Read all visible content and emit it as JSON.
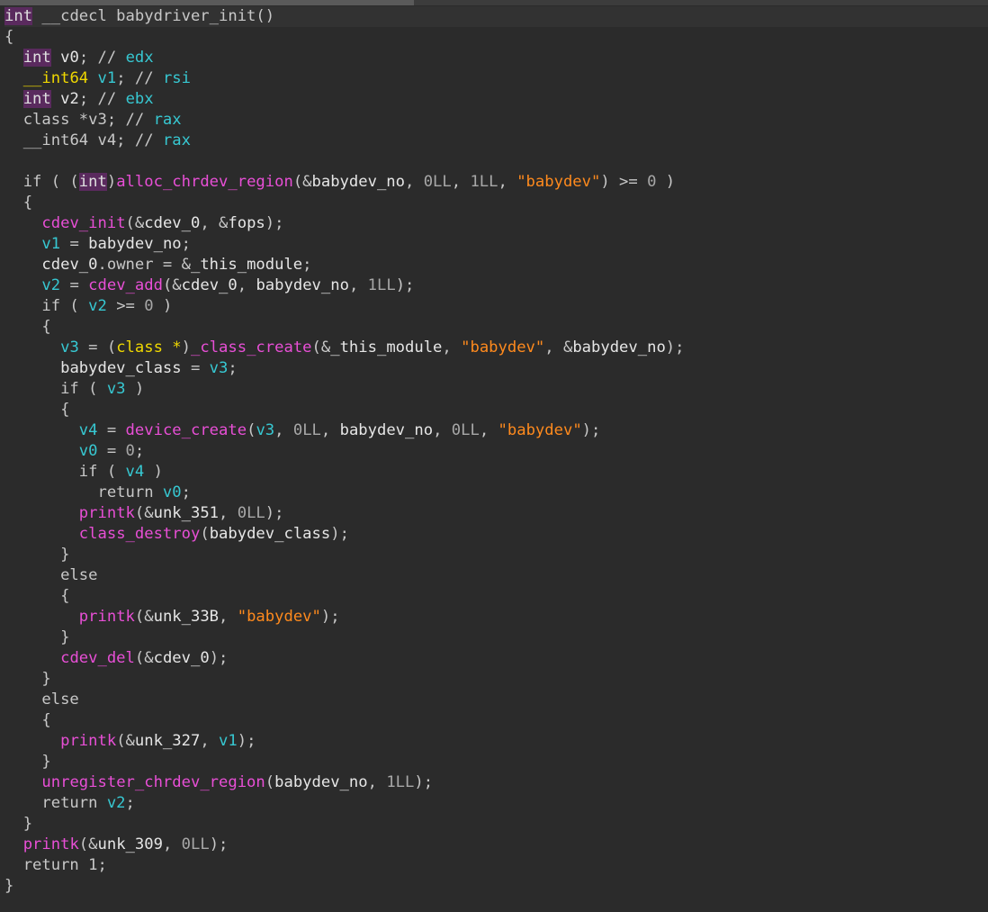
{
  "editor": {
    "lines": [
      [
        [
          "type",
          "int"
        ],
        [
          "default",
          " __cdecl babydriver_init()"
        ]
      ],
      [
        [
          "default",
          "{"
        ]
      ],
      [
        [
          "default",
          "  "
        ],
        [
          "type",
          "int"
        ],
        [
          "default",
          " "
        ],
        [
          "ident",
          "v0"
        ],
        [
          "default",
          "; // "
        ],
        [
          "reg",
          "edx"
        ]
      ],
      [
        [
          "default",
          "  "
        ],
        [
          "int64",
          "__int64"
        ],
        [
          "default",
          " "
        ],
        [
          "var",
          "v1"
        ],
        [
          "default",
          "; // "
        ],
        [
          "reg",
          "rsi"
        ]
      ],
      [
        [
          "default",
          "  "
        ],
        [
          "type",
          "int"
        ],
        [
          "default",
          " "
        ],
        [
          "ident",
          "v2"
        ],
        [
          "default",
          "; // "
        ],
        [
          "reg",
          "ebx"
        ]
      ],
      [
        [
          "default",
          "  "
        ],
        [
          "default",
          "class *v3; // "
        ],
        [
          "reg",
          "rax"
        ]
      ],
      [
        [
          "default",
          "  "
        ],
        [
          "default",
          "__int64 v4; // "
        ],
        [
          "reg",
          "rax"
        ]
      ],
      [
        [
          "default",
          ""
        ]
      ],
      [
        [
          "default",
          "  if ( ("
        ],
        [
          "type",
          "int"
        ],
        [
          "default",
          ")"
        ],
        [
          "func",
          "alloc_chrdev_region"
        ],
        [
          "default",
          "(&"
        ],
        [
          "ident",
          "babydev_no"
        ],
        [
          "default",
          ", "
        ],
        [
          "num",
          "0LL"
        ],
        [
          "default",
          ", "
        ],
        [
          "num",
          "1LL"
        ],
        [
          "default",
          ", "
        ],
        [
          "str",
          "\"babydev\""
        ],
        [
          "default",
          ") >= "
        ],
        [
          "num",
          "0"
        ],
        [
          "default",
          " )"
        ]
      ],
      [
        [
          "default",
          "  {"
        ]
      ],
      [
        [
          "default",
          "    "
        ],
        [
          "func",
          "cdev_init"
        ],
        [
          "default",
          "(&"
        ],
        [
          "ident",
          "cdev_0"
        ],
        [
          "default",
          ", &"
        ],
        [
          "ident",
          "fops"
        ],
        [
          "default",
          ");"
        ]
      ],
      [
        [
          "default",
          "    "
        ],
        [
          "var",
          "v1"
        ],
        [
          "default",
          " = "
        ],
        [
          "ident",
          "babydev_no"
        ],
        [
          "default",
          ";"
        ]
      ],
      [
        [
          "default",
          "    "
        ],
        [
          "ident",
          "cdev_0"
        ],
        [
          "default",
          ".owner = &"
        ],
        [
          "ident",
          "_this_module"
        ],
        [
          "default",
          ";"
        ]
      ],
      [
        [
          "default",
          "    "
        ],
        [
          "var",
          "v2"
        ],
        [
          "default",
          " = "
        ],
        [
          "func",
          "cdev_add"
        ],
        [
          "default",
          "(&"
        ],
        [
          "ident",
          "cdev_0"
        ],
        [
          "default",
          ", "
        ],
        [
          "ident",
          "babydev_no"
        ],
        [
          "default",
          ", "
        ],
        [
          "num",
          "1LL"
        ],
        [
          "default",
          ");"
        ]
      ],
      [
        [
          "default",
          "    if ( "
        ],
        [
          "var",
          "v2"
        ],
        [
          "default",
          " >= "
        ],
        [
          "num",
          "0"
        ],
        [
          "default",
          " )"
        ]
      ],
      [
        [
          "default",
          "    {"
        ]
      ],
      [
        [
          "default",
          "      "
        ],
        [
          "var",
          "v3"
        ],
        [
          "default",
          " = ("
        ],
        [
          "classkw",
          "class *"
        ],
        [
          "default",
          ")"
        ],
        [
          "func",
          "_class_create"
        ],
        [
          "default",
          "(&"
        ],
        [
          "ident",
          "_this_module"
        ],
        [
          "default",
          ", "
        ],
        [
          "str",
          "\"babydev\""
        ],
        [
          "default",
          ", &"
        ],
        [
          "ident",
          "babydev_no"
        ],
        [
          "default",
          ");"
        ]
      ],
      [
        [
          "default",
          "      "
        ],
        [
          "ident",
          "babydev_class"
        ],
        [
          "default",
          " = "
        ],
        [
          "var",
          "v3"
        ],
        [
          "default",
          ";"
        ]
      ],
      [
        [
          "default",
          "      if ( "
        ],
        [
          "var",
          "v3"
        ],
        [
          "default",
          " )"
        ]
      ],
      [
        [
          "default",
          "      {"
        ]
      ],
      [
        [
          "default",
          "        "
        ],
        [
          "var",
          "v4"
        ],
        [
          "default",
          " = "
        ],
        [
          "func",
          "device_create"
        ],
        [
          "default",
          "("
        ],
        [
          "var",
          "v3"
        ],
        [
          "default",
          ", "
        ],
        [
          "num",
          "0LL"
        ],
        [
          "default",
          ", "
        ],
        [
          "ident",
          "babydev_no"
        ],
        [
          "default",
          ", "
        ],
        [
          "num",
          "0LL"
        ],
        [
          "default",
          ", "
        ],
        [
          "str",
          "\"babydev\""
        ],
        [
          "default",
          ");"
        ]
      ],
      [
        [
          "default",
          "        "
        ],
        [
          "var",
          "v0"
        ],
        [
          "default",
          " = "
        ],
        [
          "num",
          "0"
        ],
        [
          "default",
          ";"
        ]
      ],
      [
        [
          "default",
          "        if ( "
        ],
        [
          "var",
          "v4"
        ],
        [
          "default",
          " )"
        ]
      ],
      [
        [
          "default",
          "          return "
        ],
        [
          "var",
          "v0"
        ],
        [
          "default",
          ";"
        ]
      ],
      [
        [
          "default",
          "        "
        ],
        [
          "func",
          "printk"
        ],
        [
          "default",
          "(&"
        ],
        [
          "ident",
          "unk_351"
        ],
        [
          "default",
          ", "
        ],
        [
          "num",
          "0LL"
        ],
        [
          "default",
          ");"
        ]
      ],
      [
        [
          "default",
          "        "
        ],
        [
          "func",
          "class_destroy"
        ],
        [
          "default",
          "("
        ],
        [
          "ident",
          "babydev_class"
        ],
        [
          "default",
          ");"
        ]
      ],
      [
        [
          "default",
          "      }"
        ]
      ],
      [
        [
          "default",
          "      else"
        ]
      ],
      [
        [
          "default",
          "      {"
        ]
      ],
      [
        [
          "default",
          "        "
        ],
        [
          "func",
          "printk"
        ],
        [
          "default",
          "(&"
        ],
        [
          "ident",
          "unk_33B"
        ],
        [
          "default",
          ", "
        ],
        [
          "str",
          "\"babydev\""
        ],
        [
          "default",
          ");"
        ]
      ],
      [
        [
          "default",
          "      }"
        ]
      ],
      [
        [
          "default",
          "      "
        ],
        [
          "func",
          "cdev_del"
        ],
        [
          "default",
          "(&"
        ],
        [
          "ident",
          "cdev_0"
        ],
        [
          "default",
          ");"
        ]
      ],
      [
        [
          "default",
          "    }"
        ]
      ],
      [
        [
          "default",
          "    else"
        ]
      ],
      [
        [
          "default",
          "    {"
        ]
      ],
      [
        [
          "default",
          "      "
        ],
        [
          "func",
          "printk"
        ],
        [
          "default",
          "(&"
        ],
        [
          "ident",
          "unk_327"
        ],
        [
          "default",
          ", "
        ],
        [
          "var",
          "v1"
        ],
        [
          "default",
          ");"
        ]
      ],
      [
        [
          "default",
          "    }"
        ]
      ],
      [
        [
          "default",
          "    "
        ],
        [
          "func",
          "unregister_chrdev_region"
        ],
        [
          "default",
          "("
        ],
        [
          "ident",
          "babydev_no"
        ],
        [
          "default",
          ", "
        ],
        [
          "num",
          "1LL"
        ],
        [
          "default",
          ");"
        ]
      ],
      [
        [
          "default",
          "    return "
        ],
        [
          "var",
          "v2"
        ],
        [
          "default",
          ";"
        ]
      ],
      [
        [
          "default",
          "  }"
        ]
      ],
      [
        [
          "default",
          "  "
        ],
        [
          "func",
          "printk"
        ],
        [
          "default",
          "(&"
        ],
        [
          "ident",
          "unk_309"
        ],
        [
          "default",
          ", "
        ],
        [
          "num",
          "0LL"
        ],
        [
          "default",
          ");"
        ]
      ],
      [
        [
          "default",
          "  return 1;"
        ]
      ],
      [
        [
          "default",
          "}"
        ]
      ]
    ]
  },
  "colors": {
    "background": "#2b2b2b",
    "default": "#c8c8c8",
    "type_highlight": "#5a2a5e",
    "int64": "#f0d800",
    "variable": "#37c8d2",
    "function": "#e84fd6",
    "string": "#ff8a1d",
    "number": "#a8a8a8"
  }
}
